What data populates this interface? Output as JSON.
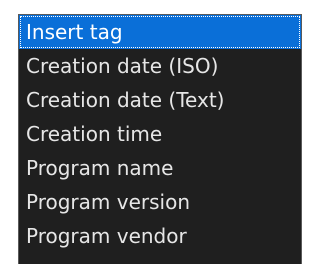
{
  "dropdown": {
    "selected_index": 0,
    "items": [
      {
        "label": "Insert tag"
      },
      {
        "label": "Creation date (ISO)"
      },
      {
        "label": "Creation date (Text)"
      },
      {
        "label": "Creation time"
      },
      {
        "label": "Program name"
      },
      {
        "label": "Program version"
      },
      {
        "label": "Program vendor"
      }
    ]
  }
}
